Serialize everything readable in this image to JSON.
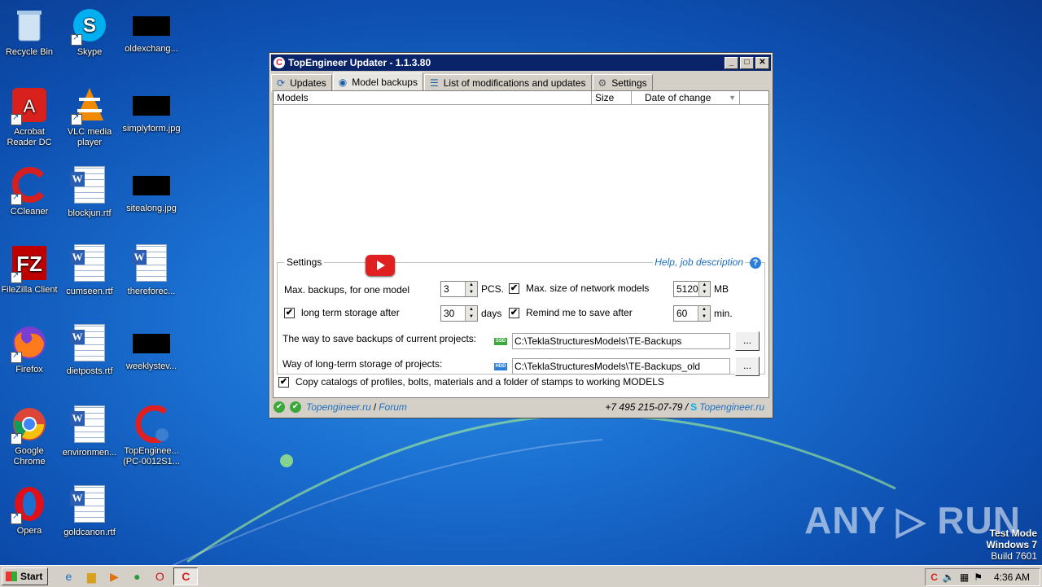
{
  "desktop": {
    "icons": [
      {
        "label": "Recycle Bin",
        "icon": "recycle-bin-icon"
      },
      {
        "label": "Skype",
        "icon": "skype-icon"
      },
      {
        "label": "oldexchang...",
        "icon": "image-file-icon"
      },
      {
        "label": "Acrobat Reader DC",
        "icon": "acrobat-icon"
      },
      {
        "label": "VLC media player",
        "icon": "vlc-icon"
      },
      {
        "label": "simplyform.jpg",
        "icon": "image-file-icon"
      },
      {
        "label": "CCleaner",
        "icon": "ccleaner-icon"
      },
      {
        "label": "blockjun.rtf",
        "icon": "word-doc-icon"
      },
      {
        "label": "sitealong.jpg",
        "icon": "image-file-icon"
      },
      {
        "label": "FileZilla Client",
        "icon": "filezilla-icon"
      },
      {
        "label": "cumseen.rtf",
        "icon": "word-doc-icon"
      },
      {
        "label": "thereforec...",
        "icon": "word-doc-icon"
      },
      {
        "label": "Firefox",
        "icon": "firefox-icon"
      },
      {
        "label": "dietposts.rtf",
        "icon": "word-doc-icon"
      },
      {
        "label": "weeklystev...",
        "icon": "image-file-icon"
      },
      {
        "label": "Google Chrome",
        "icon": "chrome-icon"
      },
      {
        "label": "environmen...",
        "icon": "word-doc-icon"
      },
      {
        "label": "TopEnginee... (PC-0012S1...",
        "icon": "topengineer-icon"
      },
      {
        "label": "Opera",
        "icon": "opera-icon"
      },
      {
        "label": "goldcanon.rtf",
        "icon": "word-doc-icon"
      }
    ]
  },
  "window": {
    "title": "TopEngineer Updater - 1.1.3.80",
    "app_icon": "C",
    "minimize": "_",
    "maximize": "□",
    "close": "✕",
    "tabs": [
      {
        "label": "Updates",
        "icon": "⟳"
      },
      {
        "label": "Model backups",
        "icon": "◉"
      },
      {
        "label": "List of modifications and updates",
        "icon": "☰"
      },
      {
        "label": "Settings",
        "icon": "⚙"
      }
    ],
    "list": {
      "columns": [
        "Models",
        "Size",
        "Date of change"
      ],
      "sort_arrow": "▼"
    },
    "settings": {
      "legend": "Settings",
      "help_link": "Help, job description",
      "help_icon": "?",
      "max_backups_label": "Max. backups, for one model",
      "max_backups_value": "3",
      "max_backups_unit": "PCS.",
      "max_network_label": "Max. size of network models",
      "max_network_value": "5120",
      "max_network_unit": "MB",
      "long_term_label": "long term storage after",
      "long_term_value": "30",
      "long_term_unit": "days",
      "remind_label": "Remind me to save after",
      "remind_value": "60",
      "remind_unit": "min.",
      "current_path_label": "The way to save backups of current projects:",
      "current_drive": "SSD",
      "current_path": "C:\\TeklaStructuresModels\\TE-Backups",
      "longterm_path_label": "Way of long-term storage of projects:",
      "longterm_drive": "HDD",
      "longterm_path": "C:\\TeklaStructuresModels\\TE-Backups_old",
      "browse": "...",
      "copy_catalogs_label": "Copy catalogs of profiles, bolts, materials and a folder of stamps to working MODELS",
      "check": "✔"
    },
    "status": {
      "site": "Topengineer.ru",
      "sep": "/",
      "forum": "Forum",
      "phone": "+7 495 215-07-79 /",
      "skype": "Topengineer.ru"
    }
  },
  "taskbar": {
    "start": "Start",
    "clock": "4:36 AM"
  },
  "watermark": "ANY ▷ RUN",
  "test_mode": {
    "line1": "Test Mode",
    "line2": "Windows 7",
    "line3": "Build 7601"
  }
}
